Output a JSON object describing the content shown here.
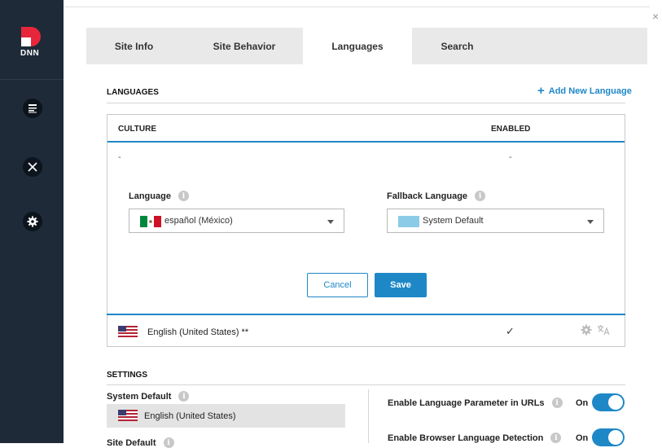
{
  "sidebar": {
    "logo_text": "DNN",
    "items": [
      {
        "name": "content-icon"
      },
      {
        "name": "tools-icon"
      },
      {
        "name": "settings-icon"
      }
    ]
  },
  "window": {
    "close_label": "×"
  },
  "tabs": [
    {
      "label": "Site Info"
    },
    {
      "label": "Site Behavior"
    },
    {
      "label": "Languages",
      "active": true
    },
    {
      "label": "Search"
    }
  ],
  "languages": {
    "title": "LANGUAGES",
    "add_label": "Add New Language",
    "add_icon": "+",
    "columns": {
      "culture": "CULTURE",
      "enabled": "ENABLED"
    },
    "edit_row": {
      "culture_value": "-",
      "enabled_value": "-",
      "language_label": "Language",
      "language_value": "español (México)",
      "fallback_label": "Fallback Language",
      "fallback_value": "System Default",
      "cancel_label": "Cancel",
      "save_label": "Save"
    },
    "rows": [
      {
        "culture": "English (United States) **",
        "enabled": "✓"
      }
    ]
  },
  "settings": {
    "title": "SETTINGS",
    "system_default_label": "System Default",
    "system_default_value": "English (United States)",
    "site_default_label": "Site Default",
    "enable_param_label": "Enable Language Parameter in URLs",
    "enable_param_state": "On",
    "enable_browser_label": "Enable Browser Language Detection",
    "enable_browser_state": "On"
  },
  "info_glyph": "i",
  "colors": {
    "accent": "#1e88c7",
    "sidebar": "#1e2a38"
  }
}
